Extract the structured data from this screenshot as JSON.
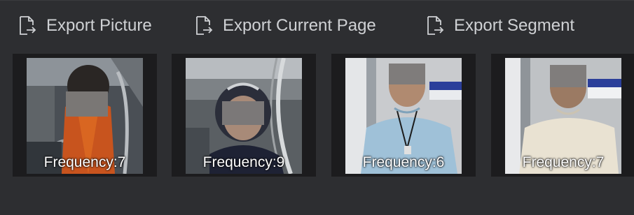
{
  "toolbar": {
    "items": [
      {
        "label": "Export Picture",
        "icon": "export-file-icon"
      },
      {
        "label": "Export Current Page",
        "icon": "export-file-icon"
      },
      {
        "label": "Export Segment",
        "icon": "export-file-icon"
      }
    ]
  },
  "thumbnails": [
    {
      "frequency_label": "Frequency:7"
    },
    {
      "frequency_label": "Frequency:9"
    },
    {
      "frequency_label": "Frequency:6"
    },
    {
      "frequency_label": "Frequency:7"
    }
  ],
  "colors": {
    "background": "#2d2e31",
    "toolbar_text": "#cfd1d4",
    "card_background": "#1c1c1e",
    "label_text": "#ffffff"
  }
}
